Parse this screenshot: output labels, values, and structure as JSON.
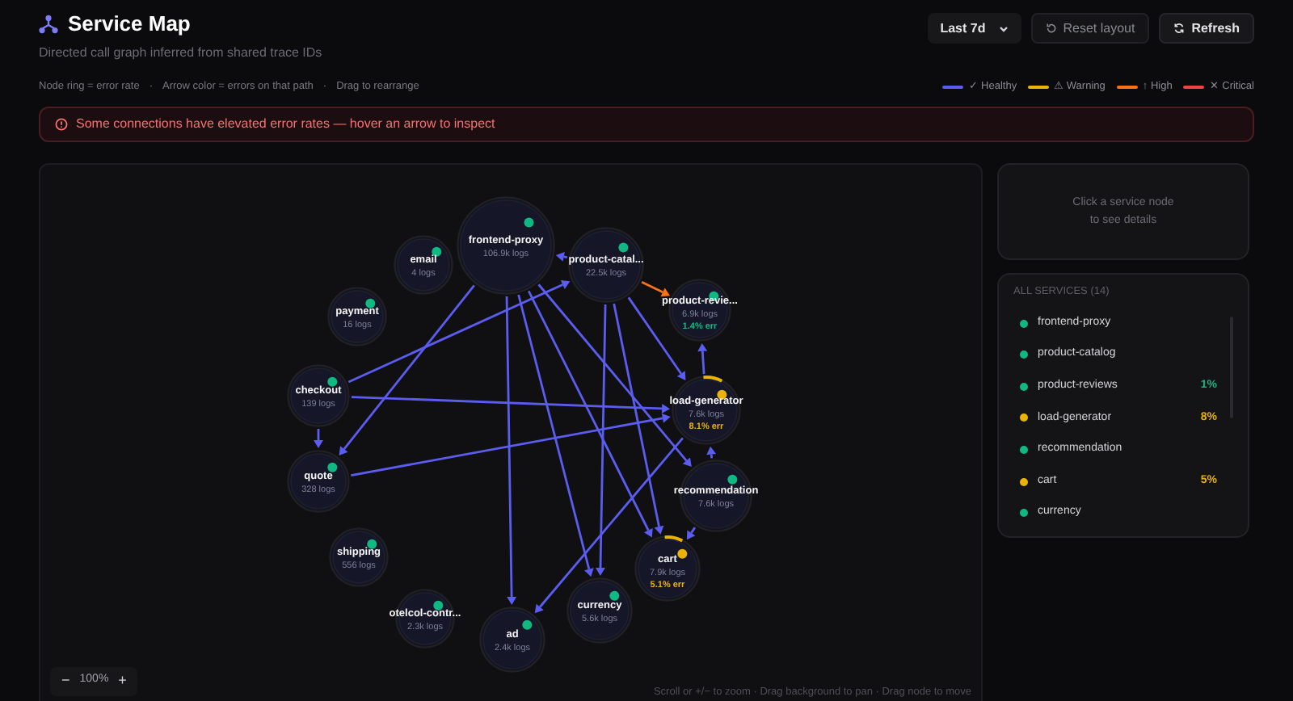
{
  "header": {
    "title": "Service Map",
    "subtitle": "Directed call graph inferred from shared trace IDs"
  },
  "controls": {
    "range": "Last 7d",
    "reset": "Reset layout",
    "refresh": "Refresh"
  },
  "hints": [
    "Node ring = error rate",
    "Arrow color = errors on that path",
    "Drag to rearrange"
  ],
  "hint_separator": "·",
  "legend": [
    {
      "label": "✓ Healthy",
      "color": "#5b5cf0"
    },
    {
      "label": "⚠ Warning",
      "color": "#eab308"
    },
    {
      "label": "↑ High",
      "color": "#f97316"
    },
    {
      "label": "✕ Critical",
      "color": "#ef4444"
    }
  ],
  "alert": "Some connections have elevated error rates — hover an arrow to inspect",
  "graph": {
    "nodes": [
      {
        "label": "email",
        "logs": "4 logs",
        "color": "#10b981",
        "error_ring": false
      },
      {
        "label": "frontend-proxy",
        "logs": "106.9k logs",
        "color": "#10b981",
        "error_ring": false
      },
      {
        "label": "product-catal...",
        "logs": "22.5k logs",
        "color": "#10b981",
        "error_ring": false
      },
      {
        "label": "payment",
        "logs": "16 logs",
        "color": "#10b981",
        "error_ring": false
      },
      {
        "label": "product-revie...",
        "logs": "6.9k logs",
        "error": "1.4% err",
        "color": "#10b981",
        "error_ring": false
      },
      {
        "label": "checkout",
        "logs": "139 logs",
        "color": "#10b981",
        "error_ring": false
      },
      {
        "label": "load-generator",
        "logs": "7.6k logs",
        "error": "8.1% err",
        "color": "#eab308",
        "error_ring": true
      },
      {
        "label": "quote",
        "logs": "328 logs",
        "color": "#10b981",
        "error_ring": false
      },
      {
        "label": "recommendation",
        "logs": "7.6k logs",
        "color": "#10b981",
        "error_ring": false
      },
      {
        "label": "shipping",
        "logs": "556 logs",
        "color": "#10b981",
        "error_ring": false
      },
      {
        "label": "cart",
        "logs": "7.9k logs",
        "error": "5.1% err",
        "color": "#eab308",
        "error_ring": true
      },
      {
        "label": "otelcol-contr...",
        "logs": "2.3k logs",
        "color": "#10b981",
        "error_ring": false
      },
      {
        "label": "ad",
        "logs": "2.4k logs",
        "color": "#10b981",
        "error_ring": false
      },
      {
        "label": "currency",
        "logs": "5.6k logs",
        "color": "#10b981",
        "error_ring": false
      }
    ],
    "edges": [
      {
        "color": "#5b5cf0"
      },
      {
        "color": "#5b5cf0"
      },
      {
        "color": "#5b5cf0"
      },
      {
        "color": "#5b5cf0"
      },
      {
        "color": "#5b5cf0"
      },
      {
        "color": "#5b5cf0"
      },
      {
        "color": "#f97316"
      },
      {
        "color": "#5b5cf0"
      },
      {
        "color": "#5b5cf0"
      },
      {
        "color": "#5b5cf0"
      },
      {
        "color": "#5b5cf0"
      },
      {
        "color": "#5b5cf0"
      },
      {
        "color": "#5b5cf0"
      },
      {
        "color": "#5b5cf0"
      },
      {
        "color": "#5b5cf0"
      },
      {
        "color": "#5b5cf0"
      },
      {
        "color": "#5b5cf0"
      },
      {
        "color": "#5b5cf0"
      }
    ],
    "zoom": "100%",
    "zoom_out": "−",
    "zoom_in": "+",
    "help": "Scroll or +/− to zoom · Drag background to pan · Drag node to move"
  },
  "details": {
    "placeholder_lines": [
      "Click a service node",
      "to see details"
    ]
  },
  "services": {
    "title": "ALL SERVICES (14)",
    "items": [
      {
        "name": "frontend-proxy",
        "color": "#10b981"
      },
      {
        "name": "product-catalog",
        "color": "#10b981"
      },
      {
        "name": "product-reviews",
        "color": "#10b981",
        "rate": "1%"
      },
      {
        "name": "load-generator",
        "color": "#eab308",
        "rate": "8%"
      },
      {
        "name": "recommendation",
        "color": "#10b981"
      },
      {
        "name": "cart",
        "color": "#eab308",
        "rate": "5%"
      },
      {
        "name": "currency",
        "color": "#10b981"
      }
    ]
  }
}
